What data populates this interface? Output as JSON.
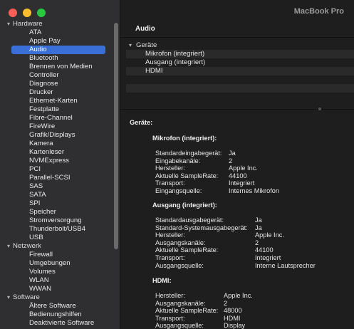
{
  "window": {
    "title": "MacBook Pro"
  },
  "sidebar": {
    "groups": [
      {
        "label": "Hardware",
        "items": [
          "ATA",
          "Apple Pay",
          "Audio",
          "Bluetooth",
          "Brennen von Medien",
          "Controller",
          "Diagnose",
          "Drucker",
          "Ethernet-Karten",
          "Festplatte",
          "Fibre-Channel",
          "FireWire",
          "Grafik/Displays",
          "Kamera",
          "Kartenleser",
          "NVMExpress",
          "PCI",
          "Parallel-SCSI",
          "SAS",
          "SATA",
          "SPI",
          "Speicher",
          "Stromversorgung",
          "Thunderbolt/USB4",
          "USB"
        ]
      },
      {
        "label": "Netzwerk",
        "items": [
          "Firewall",
          "Umgebungen",
          "Volumes",
          "WLAN",
          "WWAN"
        ]
      },
      {
        "label": "Software",
        "items": [
          "Ältere Software",
          "Bedienungshilfen",
          "Deaktivierte Software"
        ]
      }
    ],
    "selected": "Audio"
  },
  "main": {
    "section_title": "Audio",
    "list": {
      "group": "Geräte",
      "items": [
        "Mikrofon (integriert)",
        "Ausgang (integriert)",
        "HDMI"
      ]
    },
    "detail": {
      "heading": "Geräte:",
      "devices": [
        {
          "name": "Mikrofon (integriert):",
          "props": [
            [
              "Standardeingabegerät:",
              "Ja"
            ],
            [
              "Eingabekanäle:",
              "2"
            ],
            [
              "Hersteller:",
              "Apple Inc."
            ],
            [
              "Aktuelle SampleRate:",
              "44100"
            ],
            [
              "Transport:",
              "Integriert"
            ],
            [
              "Eingangsquelle:",
              "Internes Mikrofon"
            ]
          ]
        },
        {
          "name": "Ausgang (integriert):",
          "props": [
            [
              "Standardausgabegerät:",
              "Ja"
            ],
            [
              "Standard-Systemausgabegerät:",
              "Ja"
            ],
            [
              "Hersteller:",
              "Apple Inc."
            ],
            [
              "Ausgangskanäle:",
              "2"
            ],
            [
              "Aktuelle SampleRate:",
              "44100"
            ],
            [
              "Transport:",
              "Integriert"
            ],
            [
              "Ausgangsquelle:",
              "Interne Lautsprecher"
            ]
          ]
        },
        {
          "name": "HDMI:",
          "props": [
            [
              "Hersteller:",
              "Apple Inc."
            ],
            [
              "Ausgangskanäle:",
              "2"
            ],
            [
              "Aktuelle SampleRate:",
              "48000"
            ],
            [
              "Transport:",
              "HDMI"
            ],
            [
              "Ausgangsquelle:",
              "Display"
            ]
          ]
        }
      ]
    }
  },
  "colors": {
    "selection": "#3a6fd8",
    "sidebar_bg": "#2f2f31",
    "main_bg": "#1e1e1e"
  }
}
